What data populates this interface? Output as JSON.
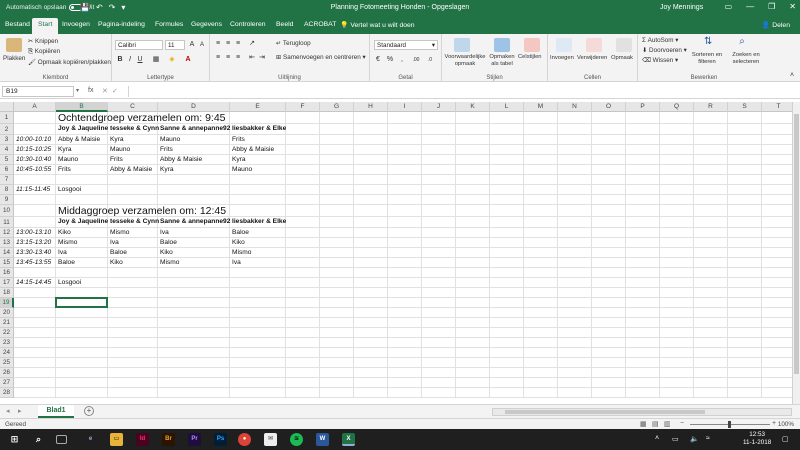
{
  "titlebar": {
    "autosave_label": "Automatisch opslaan",
    "autosave_state": "Uit",
    "doc_title": "Planning Fotomeeting Honden  -  Opgeslagen",
    "user": "Joy Mennings"
  },
  "tabs": [
    "Bestand",
    "Start",
    "Invoegen",
    "Pagina-indeling",
    "Formules",
    "Gegevens",
    "Controleren",
    "Beeld",
    "ACROBAT"
  ],
  "tellme": "Vertel wat u wilt doen",
  "share": "Delen",
  "ribbon": {
    "clipboard": {
      "paste": "Plakken",
      "cut": "Knippen",
      "copy": "Kopiëren",
      "format_painter": "Opmaak kopiëren/plakken",
      "label": "Klembord"
    },
    "font": {
      "name": "Calibri",
      "size": "11",
      "label": "Lettertype"
    },
    "alignment": {
      "wrap": "Terugloop",
      "merge": "Samenvoegen en centreren",
      "label": "Uitlijning"
    },
    "number": {
      "format": "Standaard",
      "label": "Getal"
    },
    "styles": {
      "conditional": "Voorwaardelijke opmaak",
      "table": "Opmaken als tabel",
      "cell": "Celstijlen",
      "label": "Stijlen"
    },
    "cells": {
      "insert": "Invoegen",
      "delete": "Verwijderen",
      "format": "Opmaak",
      "label": "Cellen"
    },
    "editing": {
      "autosum": "AutoSom",
      "fill": "Doorvoeren",
      "clear": "Wissen",
      "sort": "Sorteren en filteren",
      "find": "Zoeken en selecteren",
      "label": "Bewerken"
    }
  },
  "formula": {
    "namebox": "B19",
    "fx": "fx",
    "content": ""
  },
  "columns": [
    "A",
    "B",
    "C",
    "D",
    "E",
    "F",
    "G",
    "H",
    "I",
    "J",
    "K",
    "L",
    "M",
    "N",
    "O",
    "P",
    "Q",
    "R",
    "S",
    "T"
  ],
  "rows": [
    "1",
    "2",
    "3",
    "4",
    "5",
    "6",
    "7",
    "8",
    "9",
    "10",
    "11",
    "12",
    "13",
    "14",
    "15",
    "16",
    "17",
    "18",
    "19",
    "20",
    "21",
    "22",
    "23",
    "24",
    "25",
    "26",
    "27",
    "28"
  ],
  "sheet": {
    "title1": "Ochtendgroep verzamelen om: 9:45",
    "header1": [
      "Joy & Jaqueline",
      "tesseke & Cynn",
      "Sanne & annepanne92",
      "liesbakker & Elke"
    ],
    "morning": [
      {
        "time": "10:00-10:10",
        "b": "Abby & Maisie",
        "c": "Kyra",
        "d": "Mauno",
        "e": "Frits"
      },
      {
        "time": "10:15-10:25",
        "b": "Kyra",
        "c": "Mauno",
        "d": "Frits",
        "e": "Abby & Maisie"
      },
      {
        "time": "10:30-10:40",
        "b": "Mauno",
        "c": "Frits",
        "d": "Abby & Maisie",
        "e": "Kyra"
      },
      {
        "time": "10:45-10:55",
        "b": "Frits",
        "c": "Abby & Maisie",
        "d": "Kyra",
        "e": "Mauno"
      }
    ],
    "end1": {
      "time": "11:15-11:45",
      "b": "Losgooi"
    },
    "title2": "Middaggroep verzamelen om: 12:45",
    "header2": [
      "Joy & Jaqueline",
      "tesseke & Cynn",
      "Sanne & annepanne92",
      "liesbakker & Elke"
    ],
    "afternoon": [
      {
        "time": "13:00-13:10",
        "b": "Kiko",
        "c": "Mismo",
        "d": "Iva",
        "e": "Baloe"
      },
      {
        "time": "13:15-13:20",
        "b": "Mismo",
        "c": "Iva",
        "d": "Baloe",
        "e": "Kiko"
      },
      {
        "time": "13:30-13:40",
        "b": "Iva",
        "c": "Baloe",
        "d": "Kiko",
        "e": "Mismo"
      },
      {
        "time": "13:45-13:55",
        "b": "Baloe",
        "c": "Kiko",
        "d": "Mismo",
        "e": "Iva"
      }
    ],
    "end2": {
      "time": "14:15-14:45",
      "b": "Losgooi"
    }
  },
  "sheet_tab": "Blad1",
  "status": "Gereed",
  "zoom": "100%",
  "clock": {
    "time": "12:53",
    "date": "11-1-2018"
  },
  "colors": {
    "accent": "#217346"
  }
}
